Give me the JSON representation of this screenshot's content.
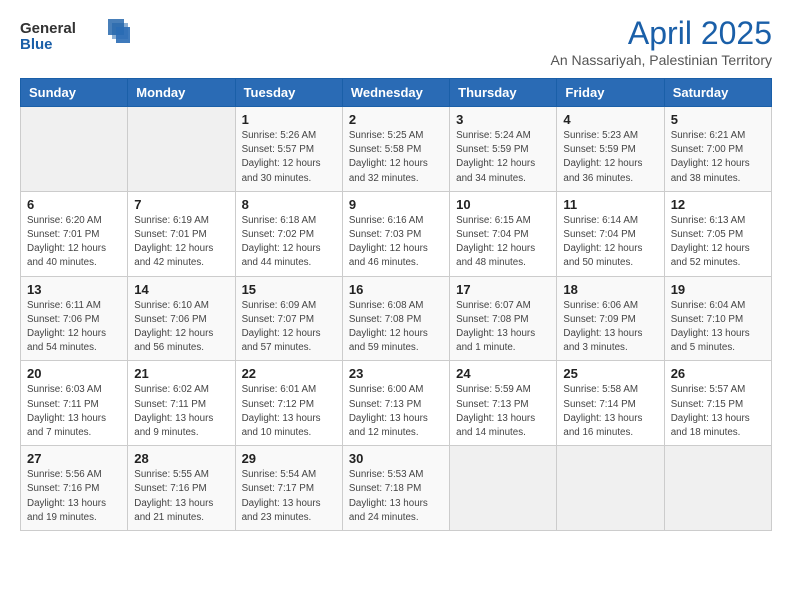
{
  "header": {
    "logo_general": "General",
    "logo_blue": "Blue",
    "month_title": "April 2025",
    "location": "An Nassariyah, Palestinian Territory"
  },
  "days_of_week": [
    "Sunday",
    "Monday",
    "Tuesday",
    "Wednesday",
    "Thursday",
    "Friday",
    "Saturday"
  ],
  "weeks": [
    [
      {
        "day": "",
        "info": ""
      },
      {
        "day": "",
        "info": ""
      },
      {
        "day": "1",
        "info": "Sunrise: 5:26 AM\nSunset: 5:57 PM\nDaylight: 12 hours\nand 30 minutes."
      },
      {
        "day": "2",
        "info": "Sunrise: 5:25 AM\nSunset: 5:58 PM\nDaylight: 12 hours\nand 32 minutes."
      },
      {
        "day": "3",
        "info": "Sunrise: 5:24 AM\nSunset: 5:59 PM\nDaylight: 12 hours\nand 34 minutes."
      },
      {
        "day": "4",
        "info": "Sunrise: 5:23 AM\nSunset: 5:59 PM\nDaylight: 12 hours\nand 36 minutes."
      },
      {
        "day": "5",
        "info": "Sunrise: 6:21 AM\nSunset: 7:00 PM\nDaylight: 12 hours\nand 38 minutes."
      }
    ],
    [
      {
        "day": "6",
        "info": "Sunrise: 6:20 AM\nSunset: 7:01 PM\nDaylight: 12 hours\nand 40 minutes."
      },
      {
        "day": "7",
        "info": "Sunrise: 6:19 AM\nSunset: 7:01 PM\nDaylight: 12 hours\nand 42 minutes."
      },
      {
        "day": "8",
        "info": "Sunrise: 6:18 AM\nSunset: 7:02 PM\nDaylight: 12 hours\nand 44 minutes."
      },
      {
        "day": "9",
        "info": "Sunrise: 6:16 AM\nSunset: 7:03 PM\nDaylight: 12 hours\nand 46 minutes."
      },
      {
        "day": "10",
        "info": "Sunrise: 6:15 AM\nSunset: 7:04 PM\nDaylight: 12 hours\nand 48 minutes."
      },
      {
        "day": "11",
        "info": "Sunrise: 6:14 AM\nSunset: 7:04 PM\nDaylight: 12 hours\nand 50 minutes."
      },
      {
        "day": "12",
        "info": "Sunrise: 6:13 AM\nSunset: 7:05 PM\nDaylight: 12 hours\nand 52 minutes."
      }
    ],
    [
      {
        "day": "13",
        "info": "Sunrise: 6:11 AM\nSunset: 7:06 PM\nDaylight: 12 hours\nand 54 minutes."
      },
      {
        "day": "14",
        "info": "Sunrise: 6:10 AM\nSunset: 7:06 PM\nDaylight: 12 hours\nand 56 minutes."
      },
      {
        "day": "15",
        "info": "Sunrise: 6:09 AM\nSunset: 7:07 PM\nDaylight: 12 hours\nand 57 minutes."
      },
      {
        "day": "16",
        "info": "Sunrise: 6:08 AM\nSunset: 7:08 PM\nDaylight: 12 hours\nand 59 minutes."
      },
      {
        "day": "17",
        "info": "Sunrise: 6:07 AM\nSunset: 7:08 PM\nDaylight: 13 hours\nand 1 minute."
      },
      {
        "day": "18",
        "info": "Sunrise: 6:06 AM\nSunset: 7:09 PM\nDaylight: 13 hours\nand 3 minutes."
      },
      {
        "day": "19",
        "info": "Sunrise: 6:04 AM\nSunset: 7:10 PM\nDaylight: 13 hours\nand 5 minutes."
      }
    ],
    [
      {
        "day": "20",
        "info": "Sunrise: 6:03 AM\nSunset: 7:11 PM\nDaylight: 13 hours\nand 7 minutes."
      },
      {
        "day": "21",
        "info": "Sunrise: 6:02 AM\nSunset: 7:11 PM\nDaylight: 13 hours\nand 9 minutes."
      },
      {
        "day": "22",
        "info": "Sunrise: 6:01 AM\nSunset: 7:12 PM\nDaylight: 13 hours\nand 10 minutes."
      },
      {
        "day": "23",
        "info": "Sunrise: 6:00 AM\nSunset: 7:13 PM\nDaylight: 13 hours\nand 12 minutes."
      },
      {
        "day": "24",
        "info": "Sunrise: 5:59 AM\nSunset: 7:13 PM\nDaylight: 13 hours\nand 14 minutes."
      },
      {
        "day": "25",
        "info": "Sunrise: 5:58 AM\nSunset: 7:14 PM\nDaylight: 13 hours\nand 16 minutes."
      },
      {
        "day": "26",
        "info": "Sunrise: 5:57 AM\nSunset: 7:15 PM\nDaylight: 13 hours\nand 18 minutes."
      }
    ],
    [
      {
        "day": "27",
        "info": "Sunrise: 5:56 AM\nSunset: 7:16 PM\nDaylight: 13 hours\nand 19 minutes."
      },
      {
        "day": "28",
        "info": "Sunrise: 5:55 AM\nSunset: 7:16 PM\nDaylight: 13 hours\nand 21 minutes."
      },
      {
        "day": "29",
        "info": "Sunrise: 5:54 AM\nSunset: 7:17 PM\nDaylight: 13 hours\nand 23 minutes."
      },
      {
        "day": "30",
        "info": "Sunrise: 5:53 AM\nSunset: 7:18 PM\nDaylight: 13 hours\nand 24 minutes."
      },
      {
        "day": "",
        "info": ""
      },
      {
        "day": "",
        "info": ""
      },
      {
        "day": "",
        "info": ""
      }
    ]
  ]
}
